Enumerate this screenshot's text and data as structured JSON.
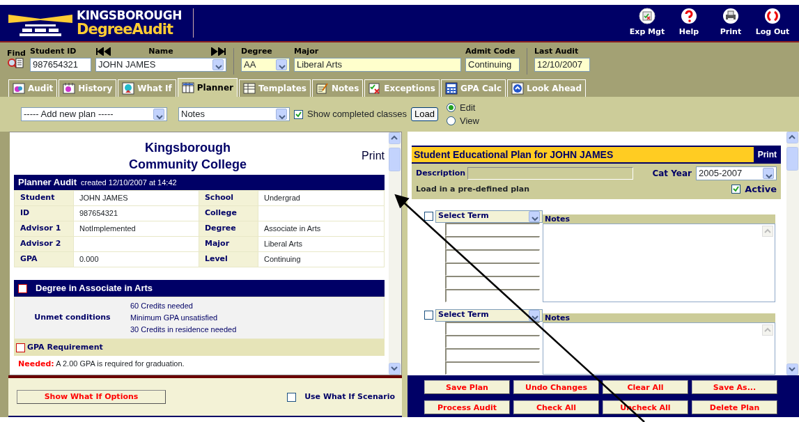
{
  "header": {
    "logo": {
      "line1": "KINGSBOROUGH",
      "line2": "DegreeAudit"
    },
    "actions": [
      {
        "label": "Exp Mgt",
        "kind": "expense"
      },
      {
        "label": "Help",
        "kind": "help"
      },
      {
        "label": "Print",
        "kind": "print"
      },
      {
        "label": "Log Out",
        "kind": "logout"
      }
    ]
  },
  "student_bar": {
    "find": "Find",
    "student_id": {
      "label": "Student ID",
      "value": "987654321"
    },
    "name": {
      "label": "Name",
      "value": "JOHN JAMES"
    },
    "degree": {
      "label": "Degree",
      "value": "AA"
    },
    "major": {
      "label": "Major",
      "value": "Liberal Arts"
    },
    "admit_code": {
      "label": "Admit Code",
      "value": "Continuing"
    },
    "last_audit": {
      "label": "Last Audit",
      "value": "12/10/2007"
    }
  },
  "tabs": [
    {
      "label": "Audit",
      "kind": "audit",
      "selected": false
    },
    {
      "label": "History",
      "kind": "history",
      "selected": false
    },
    {
      "label": "What If",
      "kind": "whatif",
      "selected": false
    },
    {
      "label": "Planner",
      "kind": "planner",
      "selected": true
    },
    {
      "label": "Templates",
      "kind": "templates",
      "selected": false
    },
    {
      "label": "Notes",
      "kind": "notes",
      "selected": false
    },
    {
      "label": "Exceptions",
      "kind": "exceptions",
      "selected": false
    },
    {
      "label": "GPA Calc",
      "kind": "calc",
      "selected": false
    },
    {
      "label": "Look Ahead",
      "kind": "lookahead",
      "selected": false
    }
  ],
  "plan_toolbar": {
    "plan_select": "----- Add new plan -----",
    "notes_select": "Notes",
    "show_completed": {
      "label": "Show completed classes",
      "checked": true
    },
    "load_button": "Load",
    "modes": [
      {
        "label": "Edit",
        "selected": true
      },
      {
        "label": "View",
        "selected": false
      }
    ]
  },
  "audit": {
    "title_lines": [
      "Kingsborough",
      "Community College"
    ],
    "print": "Print",
    "header": {
      "title": "Planner Audit",
      "created": "created 12/10/2007 at 14:42"
    },
    "info_rows": [
      {
        "label": "Student",
        "value": "JOHN JAMES",
        "label2": "School",
        "value2": "Undergrad"
      },
      {
        "label": "ID",
        "value": "987654321",
        "label2": "College"
      },
      {
        "label": "Advisor 1",
        "value": "NotImplemented",
        "label2": "Degree",
        "value2": "Associate in Arts"
      },
      {
        "label": "Advisor 2",
        "label2": "Major",
        "value2": "Liberal Arts"
      },
      {
        "label": "GPA",
        "value": "0.000",
        "label2": "Level",
        "value2": "Continuing"
      }
    ],
    "block": {
      "title": "Degree in Associate in Arts",
      "checked": false,
      "unmet_label": "Unmet conditions",
      "conditions": [
        "60 Credits needed",
        "Minimum GPA unsatisfied",
        "30 Credits in residence needed"
      ]
    },
    "requirement": {
      "title": "GPA Requirement",
      "checked": false,
      "needed_label": "Needed:",
      "needed_text": "A 2.00 GPA is required for graduation."
    }
  },
  "what_if": {
    "button": "Show What If Options",
    "scenario": {
      "label": "Use What If Scenario",
      "checked": false
    }
  },
  "plan": {
    "title": "Student Educational Plan for JOHN JAMES",
    "print": "Print",
    "description_label": "Description",
    "cat_year_label": "Cat Year",
    "cat_year": "2005-2007",
    "load_text": "Load in a pre-defined plan",
    "active": {
      "label": "Active",
      "checked": true
    },
    "terms": [
      {
        "select": "Select Term",
        "checked": false,
        "notes_label": "Notes"
      },
      {
        "select": "Select Term",
        "checked": false,
        "notes_label": "Notes"
      }
    ]
  },
  "buttons": [
    "Save Plan",
    "Undo Changes",
    "Clear All",
    "Save As...",
    "Process Audit",
    "Check All",
    "Uncheck All",
    "Delete Plan"
  ]
}
